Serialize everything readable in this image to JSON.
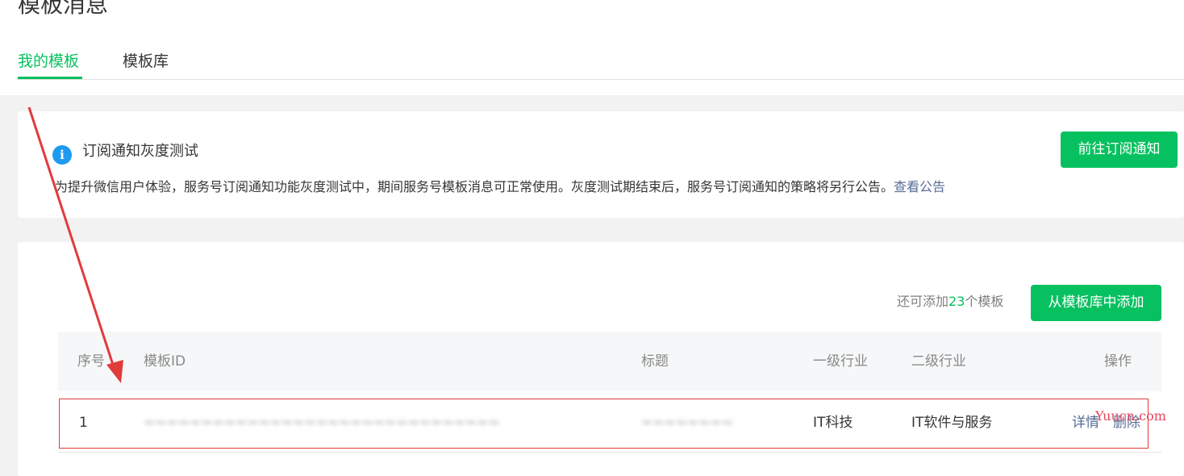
{
  "page": {
    "title": "模板消息"
  },
  "tabs": [
    {
      "label": "我的模板",
      "active": true
    },
    {
      "label": "模板库",
      "active": false
    }
  ],
  "notice": {
    "title": "订阅通知灰度测试",
    "description": "为提升微信用户体验，服务号订阅通知功能灰度测试中，期间服务号模板消息可正常使用。灰度测试期结束后，服务号订阅通知的策略将另行公告。",
    "link": "查看公告",
    "button": "前往订阅通知"
  },
  "templates": {
    "quota_prefix": "还可添加",
    "quota_count": "23",
    "quota_suffix": "个模板",
    "add_button": "从模板库中添加",
    "columns": [
      "序号",
      "模板ID",
      "标题",
      "一级行业",
      "二级行业",
      "操作"
    ],
    "rows": [
      {
        "index": "1",
        "template_id": "~~~~~~~~~~~~~~~~~~~~~~~~~~~~~~~~~~~~~~~~~~~~",
        "title": "~~~~~~~~",
        "industry_1": "IT科技",
        "industry_2": "IT软件与服务",
        "detail": "详情",
        "delete": "删除"
      }
    ]
  },
  "watermark": "Yuucn.com",
  "colors": {
    "accent": "#07c160",
    "link": "#576b95",
    "annotation": "#e23b3b"
  }
}
